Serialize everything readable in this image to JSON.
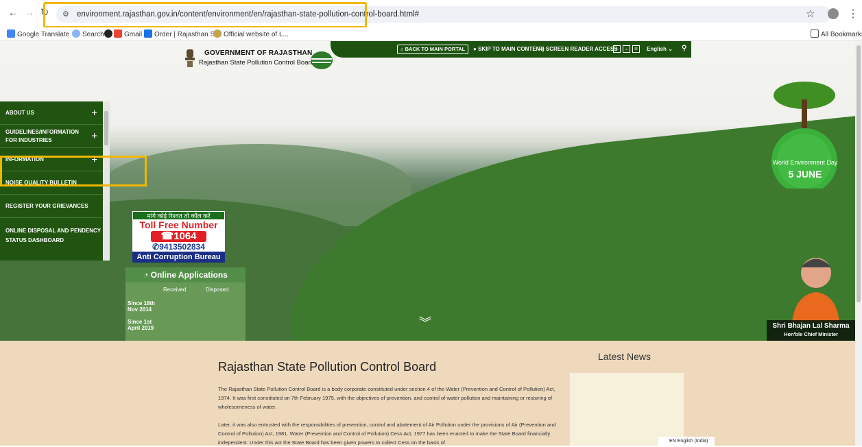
{
  "browser": {
    "url": "environment.rajasthan.gov.in/content/environment/en/rajasthan-state-pollution-control-board.html#",
    "bookmarks": [
      "Google Translate",
      "Search",
      "Gmail",
      "Order | Rajasthan St...",
      "Official website of L..."
    ],
    "all_bookmarks": "All Bookmarks"
  },
  "header": {
    "gov_title": "GOVERNMENT OF RAJASTHAN",
    "board_name": "Rajasthan State Pollution Control Board",
    "topbar": {
      "back_portal": "BACK TO MAIN PORTAL",
      "skip": "SKIP TO MAIN CONTENT",
      "screen_reader": "SCREEN READER ACCESS",
      "font_plus": "+",
      "font_normal": "-",
      "font_minus": "=",
      "language": "English"
    }
  },
  "sidebar": {
    "items": [
      {
        "label": "ABOUT US",
        "expandable": true
      },
      {
        "label": "GUIDELINES/INFORMATION FOR INDUSTRIES",
        "expandable": true
      },
      {
        "label": "INFORMATION",
        "expandable": true
      },
      {
        "label": "NOISE QUALITY BULLETIN",
        "expandable": false
      },
      {
        "label": "REGISTER YOUR GRIEVANCES",
        "expandable": false
      },
      {
        "label": "ONLINE DISPOSAL AND PENDENCY STATUS DASHBOARD",
        "expandable": false
      }
    ]
  },
  "anti_corruption": {
    "hindi": "मांगे कोई रिश्वत तो कॉल करें",
    "toll_free": "Toll Free Number",
    "number": "1064",
    "whatsapp": "9413502834",
    "bureau": "Anti Corruption Bureau"
  },
  "online_apps": {
    "title": "Online Applications",
    "col_received": "Received",
    "col_disposed": "Disposed",
    "row1_line1": "Since 18th",
    "row1_line2": "Nov 2014",
    "row2_line1": "Since 1st",
    "row2_line2": "April 2019"
  },
  "env_day": {
    "label": "World Environment Day",
    "date": "5 JUNE"
  },
  "cm": {
    "name": "Shri Bhajan Lal Sharma",
    "role": "Hon'ble Chief Minister"
  },
  "content": {
    "title": "Rajasthan State Pollution Control Board",
    "para1": "The Rajasthan State Pollution Control Board is a body corporate constituted under section 4 of the Water (Prevention and Control of Pollution) Act, 1974. It was first constituted on 7th February 1975, with the objectives of prevention, and control of water pollution and maintaining or restoring of wholesomeness of water.",
    "para2": "Later, it was also entrusted with the responsibilities of prevention, control and abatement of Air Pollution under the provisions of Air (Prevention and Control of Pollution) Act, 1981. Water (Prevention and Control of Pollution) Cess Act, 1977 has been enacted to make the State Board financially independent. Under this act the State Board has been given powers to collect Cess on the basis of",
    "news_title": "Latest News",
    "lang_widget": "EN English (India)"
  },
  "colors": {
    "green_dark": "#215410",
    "highlight": "#f2b705",
    "content_bg": "#eed9bd"
  }
}
